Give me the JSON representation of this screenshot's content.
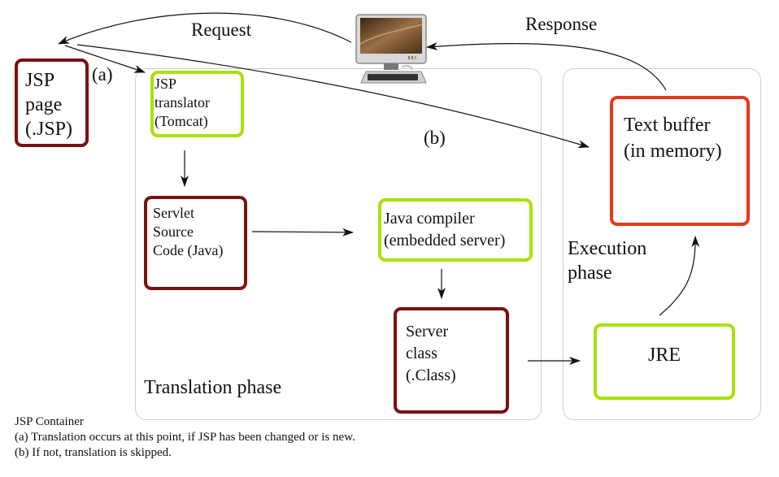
{
  "labels": {
    "request": "Request",
    "response": "Response",
    "marker_a": "(a)",
    "marker_b": "(b)",
    "translation_phase": "Translation phase",
    "execution_phase": "Execution\nphase"
  },
  "nodes": {
    "jsp_page": "JSP\npage\n(.JSP)",
    "jsp_translator": "JSP\ntranslator\n(Tomcat)",
    "servlet_source": "Servlet\nSource\nCode (Java)",
    "java_compiler": "Java compiler\n(embedded server)",
    "server_class": "Server\nclass\n(.Class)",
    "jre": "JRE",
    "text_buffer": "Text buffer\n(in memory)"
  },
  "icons": {
    "client": "desktop-computer-icon"
  },
  "colors": {
    "maroon": "#7a1212",
    "lime": "#a8e10c",
    "red": "#e8381a",
    "panel_border": "#cfcfcf"
  },
  "footnotes": {
    "title": "JSP Container",
    "a": "(a) Translation occurs at this point, if JSP has been changed or is new.",
    "b": "(b) If not, translation is skipped."
  }
}
